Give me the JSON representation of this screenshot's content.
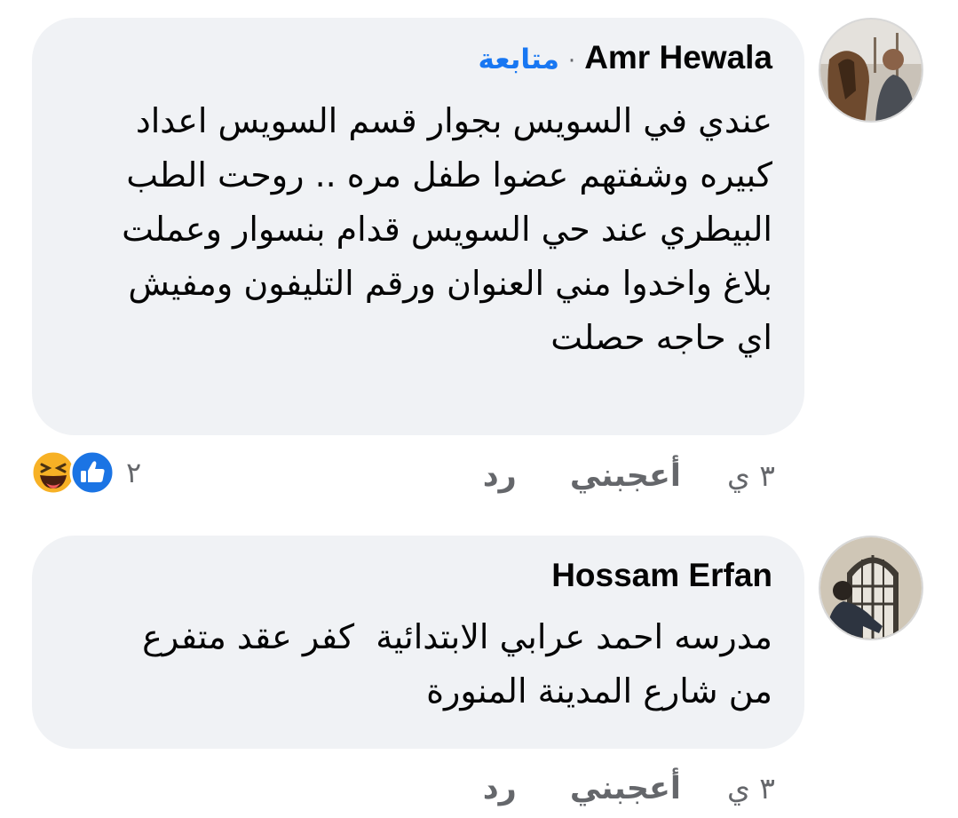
{
  "comments": [
    {
      "author": "Amr Hewala",
      "follow_label": "متابعة",
      "separator": "·",
      "lines": [
        "عندي في السويس بجوار قسم السويس اعداد",
        "كبيره وشفتهم عضوا طفل مره .. روحت الطب",
        "البيطري عند حي السويس قدام بنسوار وعملت",
        "بلاغ واخدوا مني العنوان ورقم التليفون ومفيش",
        "اي حاجه حصلت"
      ],
      "time": "٣ ي",
      "like_label": "أعجبني",
      "reply_label": "رد",
      "reaction_count": "٢",
      "reactions": [
        "like-icon",
        "haha-icon"
      ]
    },
    {
      "author": "Hossam Erfan",
      "lines": [
        "مدرسه احمد عرابي الابتدائية  كفر عقد متفرع",
        "من شارع المدينة المنورة"
      ],
      "time": "٣ ي",
      "like_label": "أعجبني",
      "reply_label": "رد"
    }
  ],
  "colors": {
    "bubble": "#f0f2f5",
    "link": "#1877f2",
    "secondary_text": "#65676b",
    "like_blue": "#1b74e4",
    "haha_yellow": "#f7b125"
  }
}
